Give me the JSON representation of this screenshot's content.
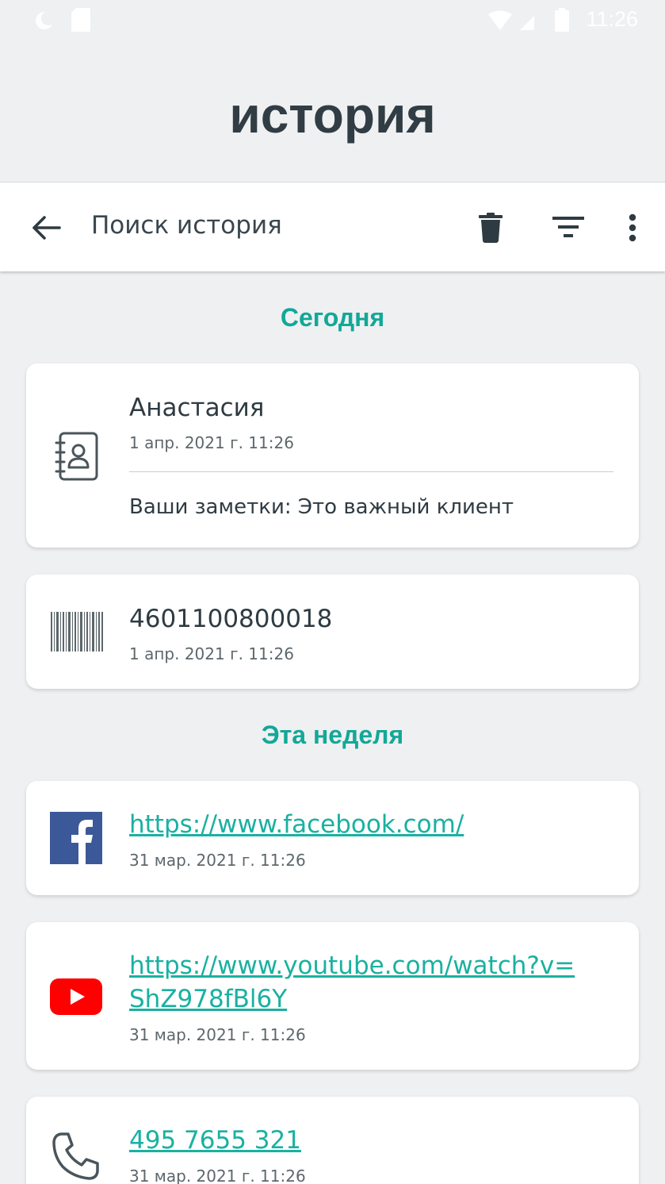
{
  "status_bar": {
    "time": "11:26"
  },
  "page_title": "история",
  "toolbar": {
    "search_label": "Поиск история"
  },
  "sections": {
    "today": "Сегодня",
    "this_week": "Эта неделя"
  },
  "items": [
    {
      "title": "Анастасия",
      "date": "1 апр. 2021 г. 11:26",
      "note": "Ваши заметки: Это важный клиент",
      "icon": "contact-book-icon"
    },
    {
      "title": "4601100800018",
      "date": "1 апр. 2021 г. 11:26",
      "icon": "barcode-icon"
    },
    {
      "title": "https://www.facebook.com/",
      "date": "31 мар. 2021 г. 11:26",
      "icon": "facebook-icon"
    },
    {
      "title_line1": "https://www.youtube.com/watch?v=",
      "title_line2": "ShZ978fBl6Y",
      "date": "31 мар. 2021 г. 11:26",
      "icon": "youtube-icon"
    },
    {
      "title": "495 7655 321",
      "date": "31 мар. 2021 г. 11:26",
      "icon": "phone-icon"
    }
  ],
  "colors": {
    "accent": "#12a898",
    "link": "#19b1a0",
    "background": "#eff0f1",
    "title": "#313d44",
    "facebook": "#3b5998",
    "youtube": "#ff0000"
  }
}
